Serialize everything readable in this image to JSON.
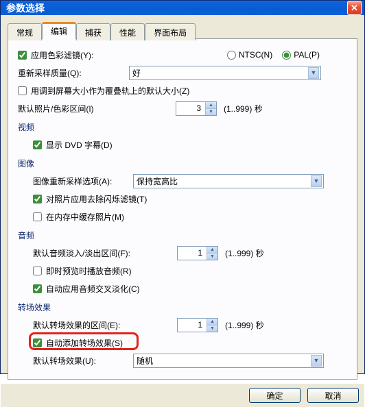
{
  "window": {
    "title": "参数选择"
  },
  "tabs": {
    "t0": "常规",
    "t1": "编辑",
    "t2": "捕获",
    "t3": "性能",
    "t4": "界面布局"
  },
  "toprow": {
    "apply_color_filter": "应用色彩滤镜(Y):",
    "ntsc": "NTSC(N)",
    "pal": "PAL(P)"
  },
  "resample": {
    "label": "重新采样质量(Q):",
    "value": "好"
  },
  "overlay_track": "用调到屏幕大小作为覆叠轨上的默认大小(Z)",
  "default_photo": {
    "label": "默认照片/色彩区间(I)",
    "value": "3",
    "range": "(1..999) 秒"
  },
  "video": {
    "header": "视频",
    "show_subtitles": "显示 DVD 字幕(D)"
  },
  "image": {
    "header": "图像",
    "resample_opt_label": "图像重新采样选项(A):",
    "resample_opt_value": "保持宽高比",
    "deflicker": "对照片应用去除闪烁滤镜(T)",
    "cache": "在内存中缓存照片(M)"
  },
  "audio": {
    "header": "音频",
    "fade_label": "默认音频淡入/淡出区间(F):",
    "fade_value": "1",
    "fade_range": "(1..999) 秒",
    "instant_play": "即时预览时播放音频(R)",
    "auto_crossfade": "自动应用音频交叉淡化(C)"
  },
  "transition": {
    "header": "转场效果",
    "default_label": "默认转场效果的区间(E):",
    "default_value": "1",
    "default_range": "(1..999) 秒",
    "auto_add": "自动添加转场效果(S)",
    "type_label": "默认转场效果(U):",
    "type_value": "随机"
  },
  "buttons": {
    "ok": "确定",
    "cancel": "取消"
  }
}
